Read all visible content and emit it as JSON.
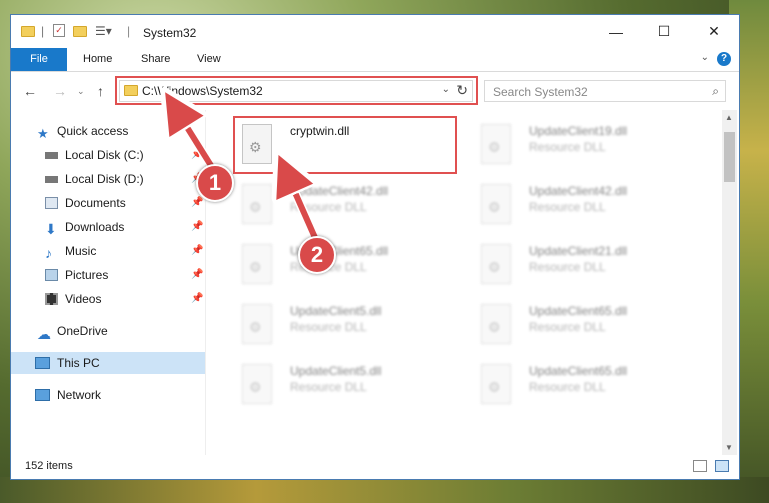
{
  "window": {
    "title": "System32",
    "controls": {
      "minimize": "—",
      "maximize": "☐",
      "close": "✕"
    }
  },
  "ribbon": {
    "tabs": [
      "File",
      "Home",
      "Share",
      "View"
    ],
    "help": "?"
  },
  "nav": {
    "address": "C:\\Windows\\System32",
    "search_placeholder": "Search System32"
  },
  "sidebar": {
    "items": [
      {
        "label": "Quick access",
        "icon": "star-icon",
        "pinned": false
      },
      {
        "label": "Local Disk (C:)",
        "icon": "drive-icon",
        "pinned": true
      },
      {
        "label": "Local Disk (D:)",
        "icon": "drive-icon",
        "pinned": true
      },
      {
        "label": "Documents",
        "icon": "documents-icon",
        "pinned": true
      },
      {
        "label": "Downloads",
        "icon": "downloads-icon",
        "pinned": true
      },
      {
        "label": "Music",
        "icon": "music-icon",
        "pinned": true
      },
      {
        "label": "Pictures",
        "icon": "pictures-icon",
        "pinned": true
      },
      {
        "label": "Videos",
        "icon": "videos-icon",
        "pinned": true
      },
      {
        "label": "OneDrive",
        "icon": "cloud-icon",
        "pinned": false
      },
      {
        "label": "This PC",
        "icon": "computer-icon",
        "pinned": false,
        "selected": true
      },
      {
        "label": "Network",
        "icon": "network-icon",
        "pinned": false
      }
    ]
  },
  "files": [
    {
      "name": "cryptwin.dll",
      "type": ""
    },
    {
      "name": "UpdateClient19.dll",
      "type": "Resource DLL"
    },
    {
      "name": "UpdateClient42.dll",
      "type": "Resource DLL"
    },
    {
      "name": "UpdateClient42.dll",
      "type": "Resource DLL"
    },
    {
      "name": "UpdateClient65.dll",
      "type": "Resource DLL"
    },
    {
      "name": "UpdateClient21.dll",
      "type": "Resource DLL"
    },
    {
      "name": "UpdateClient5.dll",
      "type": "Resource DLL"
    },
    {
      "name": "UpdateClient65.dll",
      "type": "Resource DLL"
    },
    {
      "name": "UpdateClient5.dll",
      "type": "Resource DLL"
    },
    {
      "name": "UpdateClient65.dll",
      "type": "Resource DLL"
    }
  ],
  "status": {
    "item_count": "152 items"
  },
  "annotations": {
    "step1": "1",
    "step2": "2",
    "color": "#d94a4a"
  }
}
